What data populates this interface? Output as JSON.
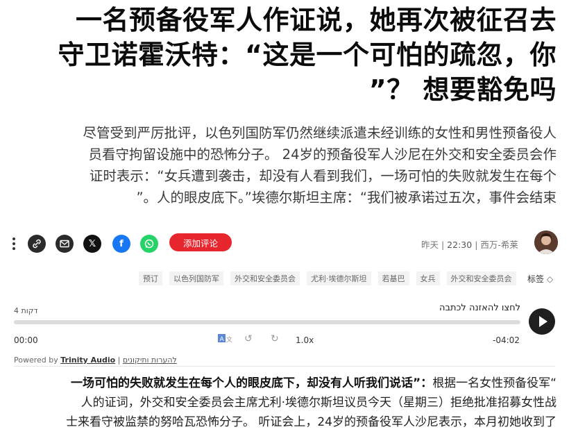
{
  "headline": {
    "lines": [
      "一名预备役军人作证说，她再次被征召去",
      "守卫诺霍沃特：“这是一个可怕的疏忽，你",
      "”？ 想要豁免吗"
    ]
  },
  "subtitle": {
    "lines": [
      "尽管受到严厉批评，以色列国防军仍然继续派遣未经训练的女性和男性预备役人",
      "员看守拘留设施中的恐怖分子。 24岁的预备役军人沙尼在外交和安全委员会作",
      "证时表示：“女兵遭到袭击，却没有人看到我们，一场可怕的失败就发生在每个",
      "”。人的眼皮底下。”埃德尔斯坦主席：“我们被承诺过五次，事件会结束"
    ]
  },
  "share": {
    "comment_label": "添加评论",
    "time_label": "昨天 |",
    "time_value": "22:30",
    "author": "西万-希莱"
  },
  "tags": {
    "label": "标签",
    "items": [
      "预订",
      "以色列国防军",
      "外交和安全委员会",
      "尤利·埃德尔斯坦",
      "若基巴",
      "女兵",
      "外交和安全委员会"
    ]
  },
  "audio": {
    "title": "לחצו להאזנה לכתבה",
    "duration": "4 דקות",
    "current": "00:00",
    "remaining": "-04:02",
    "speed": "1.0x",
    "progress": 0,
    "powered_by": "Powered by",
    "brand": "Trinity Audio",
    "feedback": "להערות ותיקונים"
  },
  "body": {
    "lead_bold": "一场可怕的失败就发生在每个人的眼皮底下，却没有人听我们说话”：",
    "lead_rest": "根据一名女性预备役军“",
    "lines": [
      "人的证词，外交和安全委员会主席尤利·埃德尔斯坦议员今天（星期三）拒绝批准招募女性战",
      "士来看守被监禁的努哈瓦恐怖分子。 听证会上，24岁的预备役军人沙尼表示，本月初她收到了"
    ]
  },
  "colors": {
    "comment_red": "#e8262e",
    "whatsapp": "#25d366",
    "facebook": "#1877f2"
  }
}
